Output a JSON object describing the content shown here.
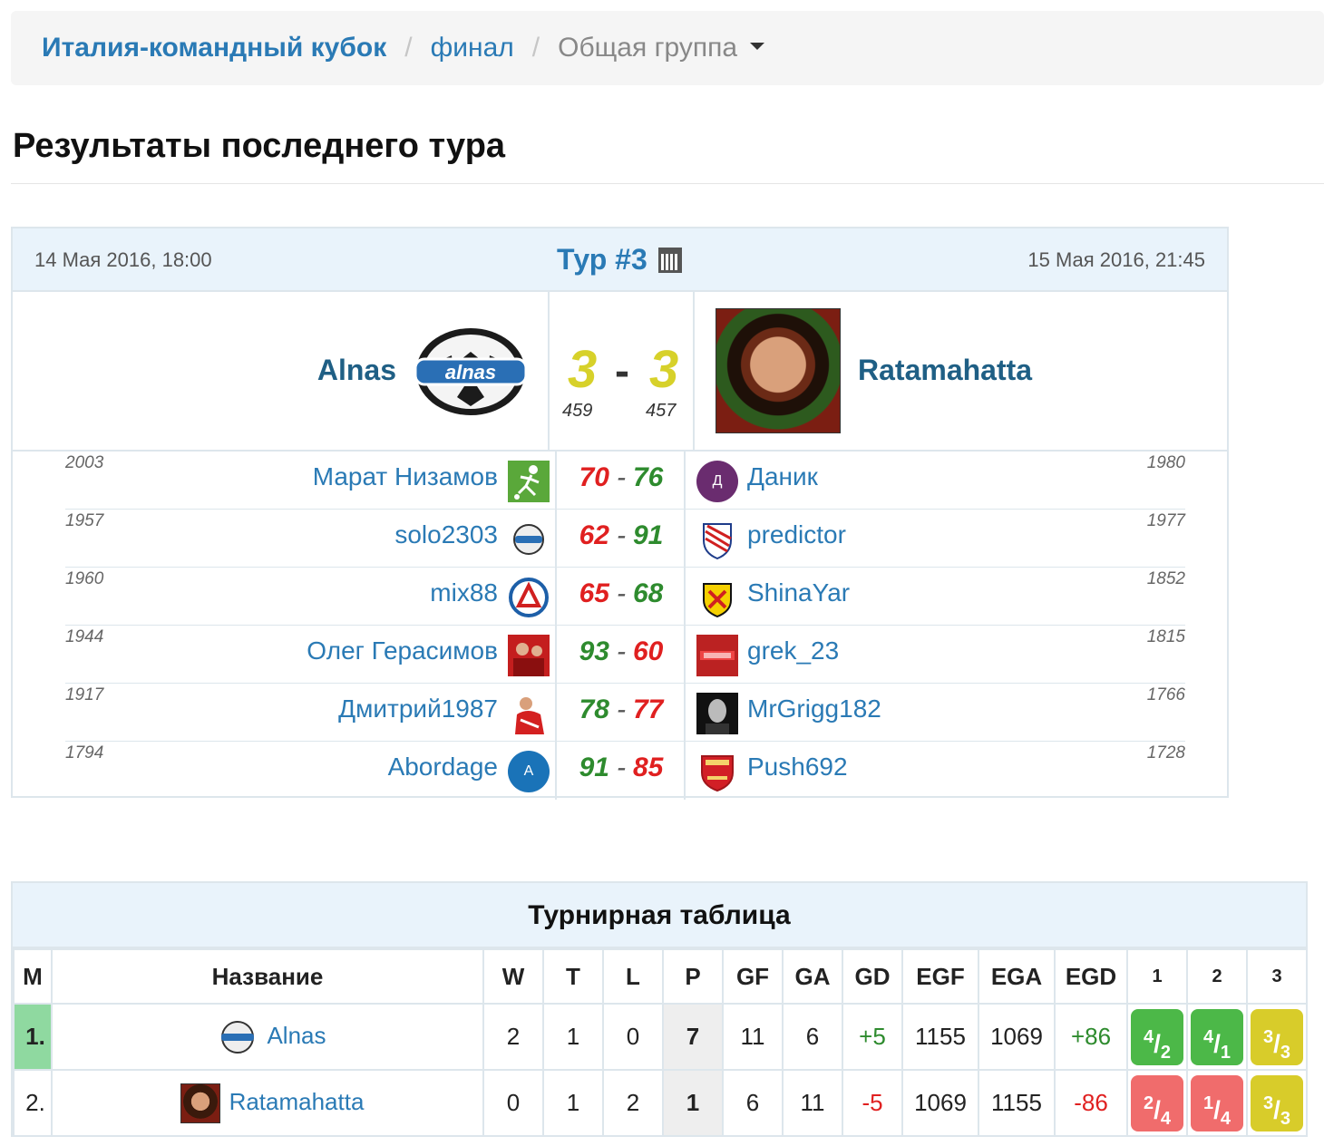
{
  "breadcrumb": {
    "items": [
      "Италия-командный кубок",
      "финал",
      "Общая группа"
    ],
    "separator": "/"
  },
  "section_title": "Результаты последнего тура",
  "match": {
    "date_start": "14 Мая 2016, 18:00",
    "date_end": "15 Мая 2016, 21:45",
    "tour_label": "Тур #3",
    "home": {
      "name": "Alnas",
      "score": "3",
      "points": "459"
    },
    "away": {
      "name": "Ratamahatta",
      "score": "3",
      "points": "457"
    },
    "score_separator": "-",
    "pairs": [
      {
        "home_rating": "2003",
        "home_player": "Марат Низамов",
        "home_score": "70",
        "away_score": "76",
        "away_player": "Даник",
        "away_rating": "1980",
        "home_color": "red",
        "away_color": "green"
      },
      {
        "home_rating": "1957",
        "home_player": "solo2303",
        "home_score": "62",
        "away_score": "91",
        "away_player": "predictor",
        "away_rating": "1977",
        "home_color": "red",
        "away_color": "green"
      },
      {
        "home_rating": "1960",
        "home_player": "mix88",
        "home_score": "65",
        "away_score": "68",
        "away_player": "ShinaYar",
        "away_rating": "1852",
        "home_color": "red",
        "away_color": "green"
      },
      {
        "home_rating": "1944",
        "home_player": "Олег Герасимов",
        "home_score": "93",
        "away_score": "60",
        "away_player": "grek_23",
        "away_rating": "1815",
        "home_color": "green",
        "away_color": "red"
      },
      {
        "home_rating": "1917",
        "home_player": "Дмитрий1987",
        "home_score": "78",
        "away_score": "77",
        "away_player": "MrGrigg182",
        "away_rating": "1766",
        "home_color": "green",
        "away_color": "red"
      },
      {
        "home_rating": "1794",
        "home_player": "Abordage",
        "home_score": "91",
        "away_score": "85",
        "away_player": "Push692",
        "away_rating": "1728",
        "home_color": "green",
        "away_color": "red"
      }
    ],
    "avatar_letters": {
      "danik": "Д",
      "abordage": "A"
    }
  },
  "standings": {
    "title": "Турнирная таблица",
    "columns": [
      "М",
      "Название",
      "W",
      "T",
      "L",
      "P",
      "GF",
      "GA",
      "GD",
      "EGF",
      "EGA",
      "EGD",
      "1",
      "2",
      "3"
    ],
    "rows": [
      {
        "pos": "1.",
        "name": "Alnas",
        "w": "2",
        "t": "1",
        "l": "0",
        "p": "7",
        "gf": "11",
        "ga": "6",
        "gd": "+5",
        "egf": "1155",
        "ega": "1069",
        "egd": "+86",
        "rounds": [
          {
            "a": "4",
            "b": "2",
            "color": "green"
          },
          {
            "a": "4",
            "b": "1",
            "color": "green"
          },
          {
            "a": "3",
            "b": "3",
            "color": "yellow"
          }
        ]
      },
      {
        "pos": "2.",
        "name": "Ratamahatta",
        "w": "0",
        "t": "1",
        "l": "2",
        "p": "1",
        "gf": "6",
        "ga": "11",
        "gd": "-5",
        "egf": "1069",
        "ega": "1155",
        "egd": "-86",
        "rounds": [
          {
            "a": "2",
            "b": "4",
            "color": "red"
          },
          {
            "a": "1",
            "b": "4",
            "color": "red"
          },
          {
            "a": "3",
            "b": "3",
            "color": "yellow"
          }
        ]
      }
    ]
  },
  "colors": {
    "link": "#2a7ab5",
    "win": "#2e8b2e",
    "loss": "#e02020",
    "draw_score": "#d7d12a",
    "panel_head": "#e9f3fb"
  }
}
